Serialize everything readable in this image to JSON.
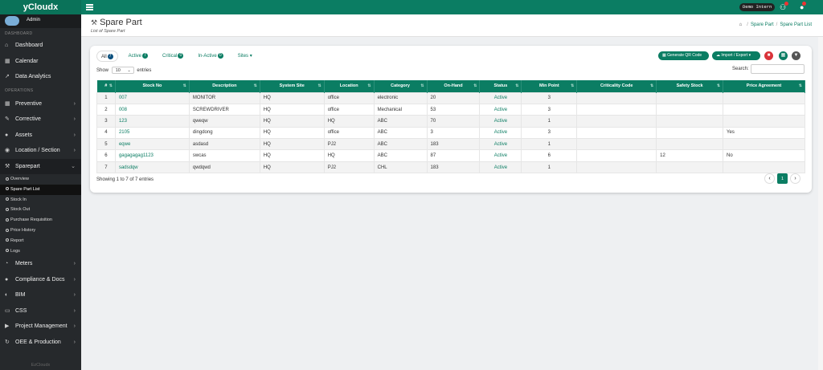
{
  "app": {
    "brand": "yCloudx"
  },
  "topbar": {
    "demo_badge": "Demo Intern"
  },
  "sidebar": {
    "user": "Admin",
    "section_dashboard": "DASHBOARD",
    "section_operations": "OPERATIONS",
    "main_items": [
      {
        "label": "Dashboard",
        "icon": "home-icon"
      },
      {
        "label": "Calendar",
        "icon": "calendar-icon"
      },
      {
        "label": "Data Analytics",
        "icon": "chart-icon"
      }
    ],
    "ops_items": [
      {
        "label": "Preventive",
        "icon": "calendar-icon"
      },
      {
        "label": "Corrective",
        "icon": "wrench-icon"
      },
      {
        "label": "Assets",
        "icon": "gear-icon"
      },
      {
        "label": "Location / Section",
        "icon": "location-icon"
      },
      {
        "label": "Sparepart",
        "icon": "tools-icon"
      }
    ],
    "sparepart_sub": [
      "Overview",
      "Spare Part List",
      "Stock In",
      "Stock Out",
      "Purchase Requisition",
      "Price History",
      "Report",
      "Logs"
    ],
    "lower_items": [
      {
        "label": "Meters",
        "icon": "gauge-icon"
      },
      {
        "label": "Compliance & Docs",
        "icon": "document-icon"
      },
      {
        "label": "BIM",
        "icon": "building-icon"
      },
      {
        "label": "CSS",
        "icon": "monitor-icon"
      },
      {
        "label": "Project Management",
        "icon": "project-icon"
      },
      {
        "label": "OEE & Production",
        "icon": "production-icon"
      }
    ],
    "footer": "EzCloudx"
  },
  "page": {
    "title": "Spare Part",
    "subtitle": "List of Spare Part",
    "breadcrumb": [
      "Spare Part",
      "Spare Part List"
    ]
  },
  "filters": {
    "tabs": [
      {
        "label": "All",
        "count": "7"
      },
      {
        "label": "Active",
        "count": "7"
      },
      {
        "label": "Critical",
        "count": "0"
      },
      {
        "label": "In-Active",
        "count": "0"
      }
    ],
    "sites_label": "Sites"
  },
  "toolbar": {
    "qr_label": "Generate QR Code",
    "import_export_label": "Import / Export"
  },
  "table_controls": {
    "show_label": "Show",
    "entries_value": "10",
    "entries_label": "entries",
    "search_label": "Search:"
  },
  "table": {
    "columns": [
      "#",
      "Stock No",
      "Description",
      "System Site",
      "Location",
      "Category",
      "On-Hand",
      "Status",
      "Min Point",
      "Criticality Code",
      "Safety Stock",
      "Price Agreement"
    ],
    "rows": [
      [
        "1",
        "007",
        "MONITOR",
        "HQ",
        "office",
        "electronic",
        "20",
        "Active",
        "3",
        "",
        "",
        ""
      ],
      [
        "2",
        "008",
        "SCREWDRIVER",
        "HQ",
        "office",
        "Mechanical",
        "53",
        "Active",
        "3",
        "",
        "",
        ""
      ],
      [
        "3",
        "123",
        "qweqw",
        "HQ",
        "HQ",
        "ABC",
        "70",
        "Active",
        "1",
        "",
        "",
        ""
      ],
      [
        "4",
        "2105",
        "dingdong",
        "HQ",
        "office",
        "ABC",
        "3",
        "Active",
        "3",
        "",
        "",
        "Yes"
      ],
      [
        "5",
        "eqwe",
        "asdasd",
        "HQ",
        "PJ2",
        "ABC",
        "183",
        "Active",
        "1",
        "",
        "",
        ""
      ],
      [
        "6",
        "gagagagag1123",
        "swcas",
        "HQ",
        "HQ",
        "ABC",
        "87",
        "Active",
        "6",
        "",
        "12",
        "No"
      ],
      [
        "7",
        "sadsdqw",
        "qwdqwd",
        "HQ",
        "PJ2",
        "CHL",
        "183",
        "Active",
        "1",
        "",
        "",
        ""
      ]
    ]
  },
  "footer": {
    "showing": "Showing 1 to 7 of 7 entries",
    "current_page": "1"
  },
  "colors": {
    "primary": "#0b7d63",
    "sidebar": "#26292c",
    "danger": "#d9343a"
  }
}
